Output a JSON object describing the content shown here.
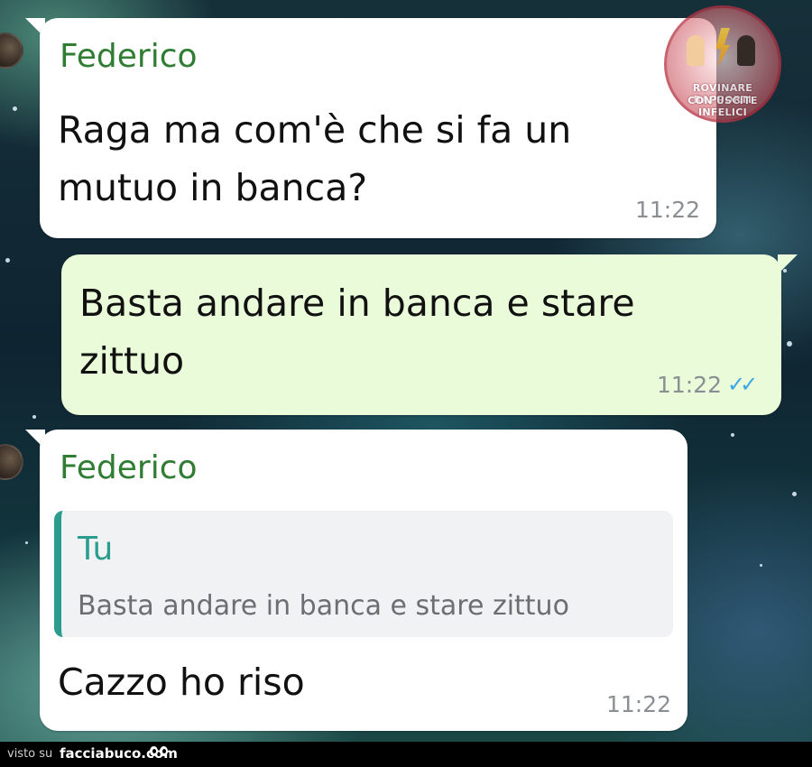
{
  "chat": {
    "messages": [
      {
        "direction": "incoming",
        "sender": "Federico",
        "lines": [
          "Raga ma com'è che si fa un",
          "mutuo in banca?"
        ],
        "time": "11:22"
      },
      {
        "direction": "outgoing",
        "lines": [
          "Basta andare in banca e stare",
          "zittuo"
        ],
        "time": "11:22",
        "status": "read"
      },
      {
        "direction": "incoming",
        "sender": "Federico",
        "reply": {
          "author": "Tu",
          "text": "Basta andare in banca e stare zittuo"
        },
        "lines": [
          "Cazzo ho riso"
        ],
        "time": "11:22"
      }
    ]
  },
  "watermark": {
    "line1": "ROVINARE RAPPORTI",
    "line2": "CON USCITE INFELICI"
  },
  "footer": {
    "prefix": "visto su",
    "site": "facciabuco.com"
  },
  "colors": {
    "incoming_bubble": "#ffffff",
    "outgoing_bubble": "#e9fbd8",
    "sender_name": "#2f7d32",
    "quote_accent": "#2a9d8f",
    "read_ticks": "#3ba6e5"
  },
  "icons": {
    "read_receipt": "double-check-icon",
    "watermark": "logo-badge-icon",
    "footer_logo": "eyes-icon"
  }
}
